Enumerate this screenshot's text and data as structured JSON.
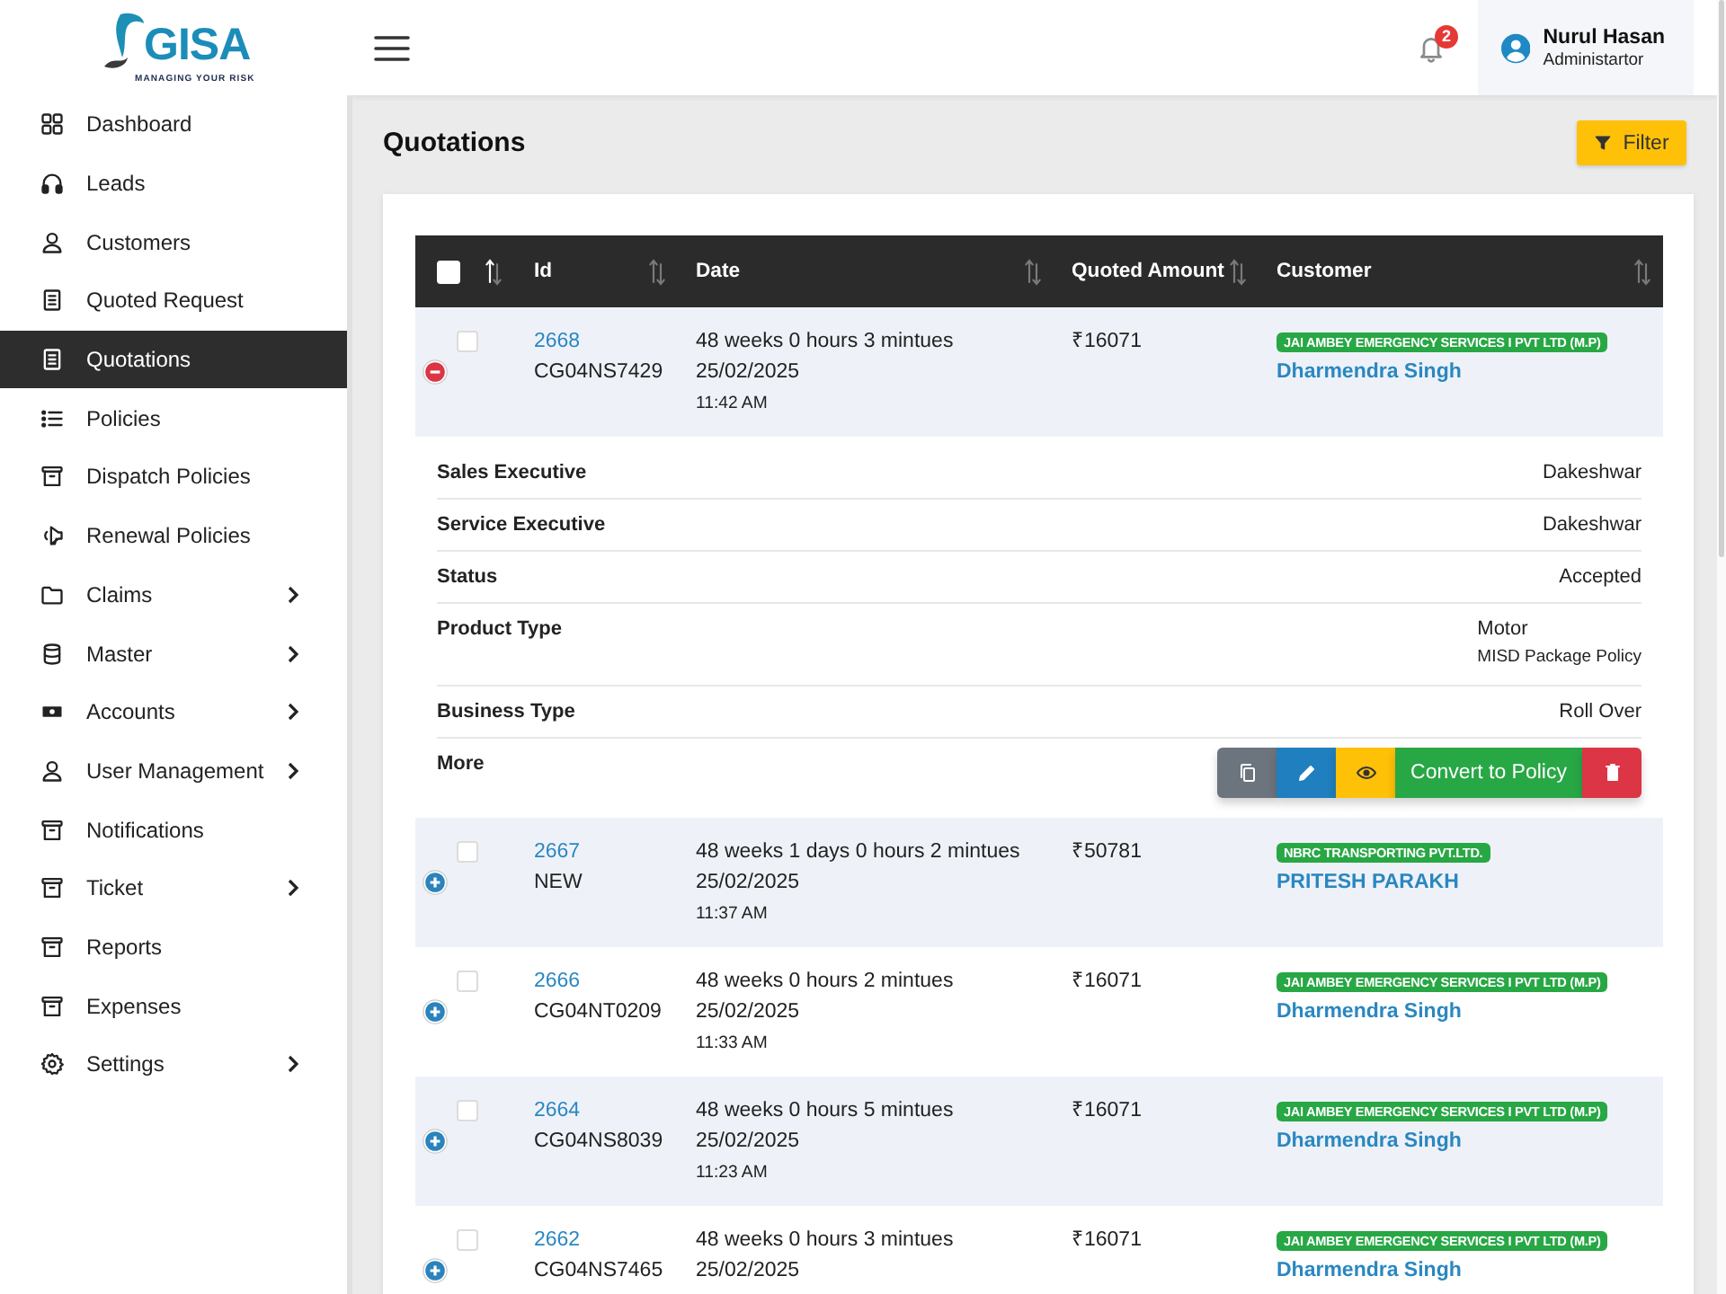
{
  "logo": {
    "text": "GISA",
    "tagline": "MANAGING YOUR RISK"
  },
  "sidebar": {
    "items": [
      {
        "label": "Dashboard",
        "selected": false,
        "submenu": false
      },
      {
        "label": "Leads",
        "selected": false,
        "submenu": false
      },
      {
        "label": "Customers",
        "selected": false,
        "submenu": false
      },
      {
        "label": "Quoted Request",
        "selected": false,
        "submenu": false
      },
      {
        "label": "Quotations",
        "selected": true,
        "submenu": false
      },
      {
        "label": "Policies",
        "selected": false,
        "submenu": false
      },
      {
        "label": "Dispatch Policies",
        "selected": false,
        "submenu": false
      },
      {
        "label": "Renewal Policies",
        "selected": false,
        "submenu": false
      },
      {
        "label": "Claims",
        "selected": false,
        "submenu": true
      },
      {
        "label": "Master",
        "selected": false,
        "submenu": true
      },
      {
        "label": "Accounts",
        "selected": false,
        "submenu": true
      },
      {
        "label": "User Management",
        "selected": false,
        "submenu": true
      },
      {
        "label": "Notifications",
        "selected": false,
        "submenu": false
      },
      {
        "label": "Ticket",
        "selected": false,
        "submenu": true
      },
      {
        "label": "Reports",
        "selected": false,
        "submenu": false
      },
      {
        "label": "Expenses",
        "selected": false,
        "submenu": false
      },
      {
        "label": "Settings",
        "selected": false,
        "submenu": true
      }
    ]
  },
  "header": {
    "notification_count": "2",
    "user": {
      "name": "Nurul Hasan",
      "role": "Administartor"
    }
  },
  "page": {
    "title": "Quotations",
    "filter_button": "Filter"
  },
  "table": {
    "columns": [
      {
        "kind": "select",
        "checked": false,
        "sorted": true
      },
      {
        "kind": "text",
        "label": "Id",
        "sorted": false
      },
      {
        "kind": "text",
        "label": "Date",
        "sorted": false
      },
      {
        "kind": "text",
        "label": "Quoted Amount",
        "sorted": false
      },
      {
        "kind": "text",
        "label": "Customer",
        "sorted": false
      }
    ],
    "rows": [
      {
        "checked": false,
        "expanded": true,
        "id": "2668",
        "reference": "CG04NS7429",
        "elapsed": "48 weeks 0 hours 3 mintues",
        "date": "25/02/2025",
        "time": "11:42 AM",
        "amount": "₹16071",
        "company": "JAI AMBEY EMERGENCY SERVICES I PVT LTD (M.P)",
        "contact": "Dharmendra Singh",
        "details": [
          {
            "label": "Sales Executive",
            "value": "Dakeshwar"
          },
          {
            "label": "Service Executive",
            "value": "Dakeshwar"
          },
          {
            "label": "Status",
            "value": "Accepted"
          },
          {
            "label": "Product Type",
            "value": "Motor",
            "subvalue": "MISD Package Policy"
          },
          {
            "label": "Business Type",
            "value": "Roll Over"
          }
        ],
        "more_label": "More",
        "actions": [
          {
            "kind": "copy"
          },
          {
            "kind": "edit"
          },
          {
            "kind": "view"
          },
          {
            "kind": "convert",
            "label": "Convert to Policy"
          },
          {
            "kind": "delete"
          }
        ]
      },
      {
        "checked": false,
        "expanded": false,
        "id": "2667",
        "reference": "NEW",
        "elapsed": "48 weeks 1 days 0 hours 2 mintues",
        "date": "25/02/2025",
        "time": "11:37 AM",
        "amount": "₹50781",
        "company": "NBRC TRANSPORTING PVT.LTD.",
        "contact": "PRITESH PARAKH"
      },
      {
        "checked": false,
        "expanded": false,
        "id": "2666",
        "reference": "CG04NT0209",
        "elapsed": "48 weeks 0 hours 2 mintues",
        "date": "25/02/2025",
        "time": "11:33 AM",
        "amount": "₹16071",
        "company": "JAI AMBEY EMERGENCY SERVICES I PVT LTD (M.P)",
        "contact": "Dharmendra Singh"
      },
      {
        "checked": false,
        "expanded": false,
        "id": "2664",
        "reference": "CG04NS8039",
        "elapsed": "48 weeks 0 hours 5 mintues",
        "date": "25/02/2025",
        "time": "11:23 AM",
        "amount": "₹16071",
        "company": "JAI AMBEY EMERGENCY SERVICES I PVT LTD (M.P)",
        "contact": "Dharmendra Singh"
      },
      {
        "checked": false,
        "expanded": false,
        "id": "2662",
        "reference": "CG04NS7465",
        "elapsed": "48 weeks 0 hours 3 mintues",
        "date": "25/02/2025",
        "amount": "₹16071",
        "company": "JAI AMBEY EMERGENCY SERVICES I PVT LTD (M.P)",
        "contact": "Dharmendra Singh"
      }
    ]
  }
}
